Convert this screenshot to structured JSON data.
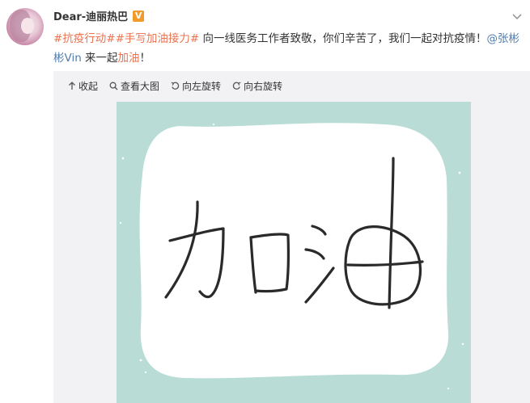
{
  "post": {
    "username": "Dear-迪丽热巴",
    "verified_label": "V",
    "topic_1": "#抗疫行动#",
    "topic_2": "#手写加油接力#",
    "text_main": " 向一线医务工作者致敬，你们辛苦了，我们一起对抗疫情！",
    "mention": "@张彬彬Vin",
    "text_tail": " 来一起",
    "highlight": "加油",
    "text_end": "！"
  },
  "toolbar": {
    "collapse_label": "收起",
    "view_large_label": "查看大图",
    "rotate_left_label": "向左旋转",
    "rotate_right_label": "向右旋转"
  },
  "image": {
    "handwriting": "加油",
    "background_color": "#b9ddd6",
    "card_color": "#ffffff"
  },
  "icons": {
    "menu": "chevron-down-icon",
    "collapse": "arrow-up-icon",
    "view_large": "search-icon",
    "rotate_left": "rotate-left-icon",
    "rotate_right": "rotate-right-icon"
  },
  "colors": {
    "topic": "#eb7350",
    "mention": "#507daf",
    "verified": "#f29a2a"
  }
}
